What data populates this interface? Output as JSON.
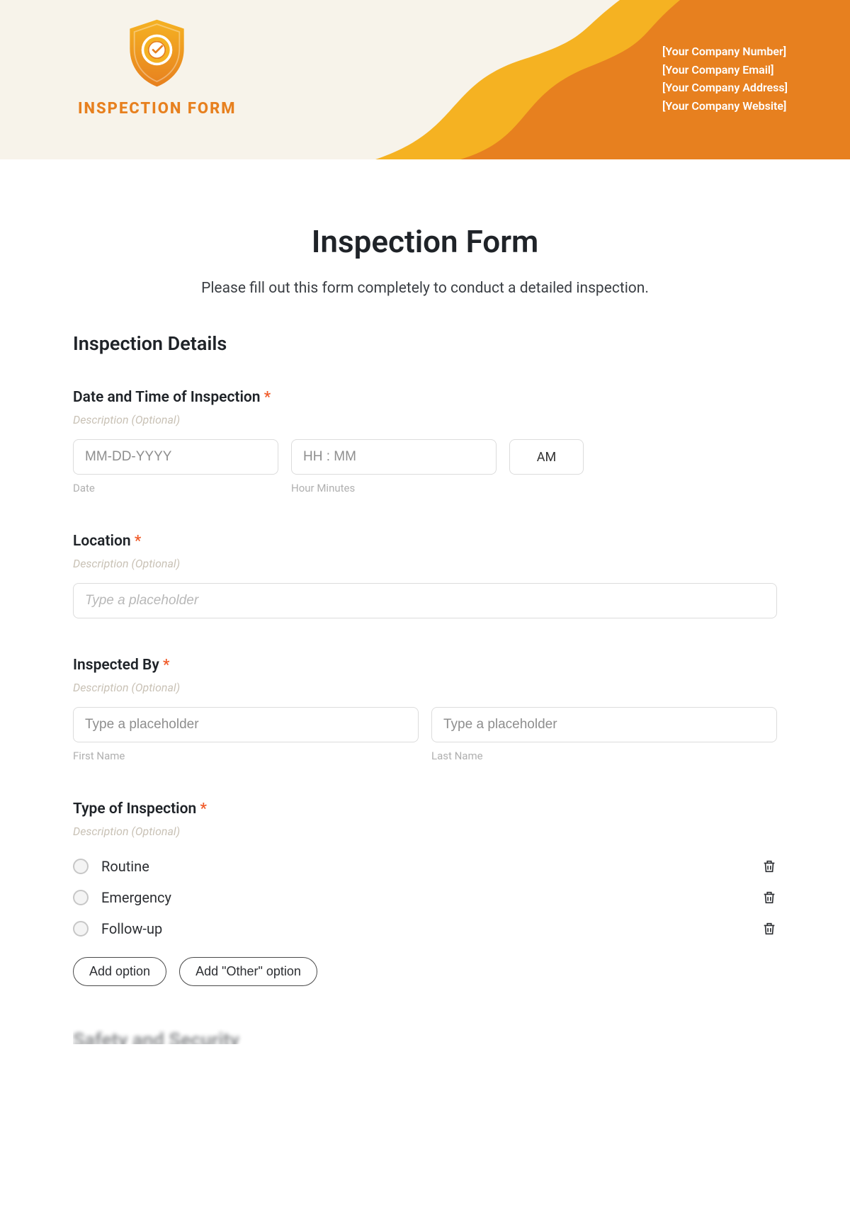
{
  "header": {
    "logo_title": "INSPECTION FORM",
    "company": {
      "number": "[Your Company Number]",
      "email": "[Your Company Email]",
      "address": "[Your Company Address]",
      "website": "[Your Company Website]"
    }
  },
  "page": {
    "title": "Inspection Form",
    "subtitle": "Please fill out this form completely to conduct a detailed inspection."
  },
  "section_details": "Inspection Details",
  "fields": {
    "datetime": {
      "label": "Date and Time of Inspection",
      "desc": "Description (Optional)",
      "date_placeholder": "MM-DD-YYYY",
      "date_caption": "Date",
      "time_placeholder": "HH : MM",
      "time_caption": "Hour Minutes",
      "ampm": "AM"
    },
    "location": {
      "label": "Location",
      "desc": "Description (Optional)",
      "placeholder": "Type a placeholder"
    },
    "inspected_by": {
      "label": "Inspected By",
      "desc": "Description (Optional)",
      "first_placeholder": "Type a placeholder",
      "first_caption": "First Name",
      "last_placeholder": "Type a placeholder",
      "last_caption": "Last Name"
    },
    "type": {
      "label": "Type of Inspection",
      "desc": "Description (Optional)",
      "options": [
        "Routine",
        "Emergency",
        "Follow-up"
      ],
      "add_option": "Add option",
      "add_other": "Add \"Other\" option"
    }
  },
  "cutoff_section": "Safety and Security"
}
